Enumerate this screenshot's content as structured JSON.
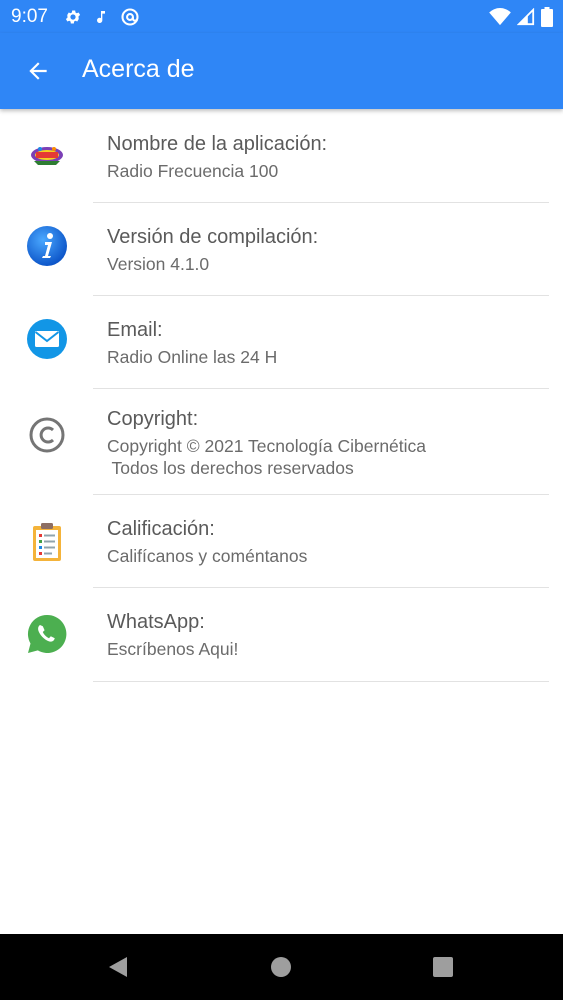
{
  "status_bar": {
    "time": "9:07",
    "left_icons": [
      "gear-icon",
      "music-note-icon",
      "at-sign-icon"
    ],
    "right_icons": [
      "wifi-icon",
      "signal-icon",
      "battery-icon"
    ]
  },
  "app_bar": {
    "title": "Acerca de",
    "color": "#2f86f6"
  },
  "items": [
    {
      "icon": "app-logo-icon",
      "title": "Nombre de la aplicación:",
      "subtitle": "Radio Frecuencia 100"
    },
    {
      "icon": "info-icon",
      "title": "Versión de compilación:",
      "subtitle": "Version 4.1.0"
    },
    {
      "icon": "mail-icon",
      "title": "Email:",
      "subtitle": "Radio Online las 24 H"
    },
    {
      "icon": "copyright-icon",
      "title": "Copyright:",
      "subtitle": "Copyright © 2021 Tecnología Cibernética\n Todos los derechos reservados"
    },
    {
      "icon": "clipboard-icon",
      "title": "Calificación:",
      "subtitle": "Califícanos y coméntanos"
    },
    {
      "icon": "whatsapp-icon",
      "title": "WhatsApp:",
      "subtitle": "Escríbenos Aqui!"
    }
  ],
  "nav_bar": {
    "buttons": [
      "back-triangle-icon",
      "home-circle-icon",
      "recents-square-icon"
    ]
  }
}
